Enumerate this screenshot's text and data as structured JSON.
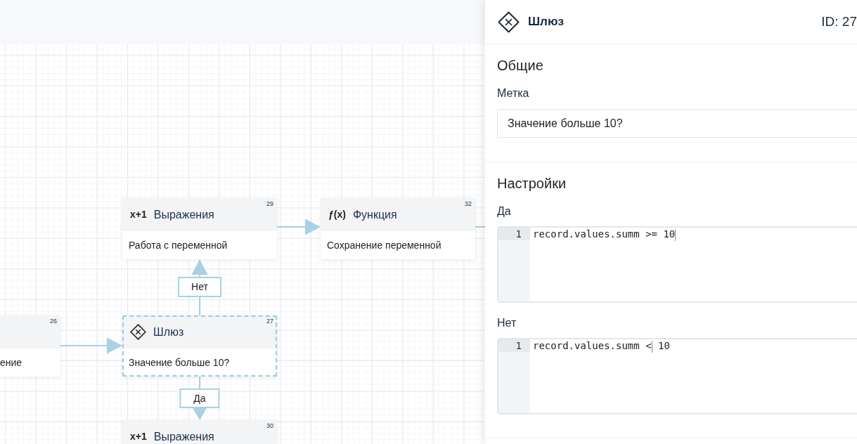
{
  "canvas": {
    "nodes": [
      {
        "kind": "expression",
        "icon": "x+1",
        "title": "Выражения",
        "number": "29",
        "description": "Работа с переменной",
        "selected": false
      },
      {
        "kind": "function",
        "icon": "ƒ(x)",
        "title": "Функция",
        "number": "32",
        "description": "Сохранение переменной",
        "selected": false
      },
      {
        "number": "26",
        "description": "ение",
        "selected": false
      },
      {
        "kind": "gateway",
        "title": "Шлюз",
        "number": "27",
        "description": "Значение больше 10?",
        "selected": true
      },
      {
        "kind": "expression",
        "icon": "x+1",
        "title": "Выражения",
        "number": "30",
        "selected": false
      }
    ],
    "edges": [
      {
        "label": "Нет"
      },
      {
        "label": "Да"
      }
    ]
  },
  "panel": {
    "kind": "gateway",
    "title": "Шлюз",
    "id_label": "ID: 27",
    "sections": [
      {
        "title": "Общие",
        "fields": [
          {
            "kind": "text",
            "label": "Метка",
            "value": "Значение больше 10?"
          }
        ]
      },
      {
        "title": "Настройки",
        "fields": [
          {
            "kind": "code",
            "label": "Да",
            "lines": [
              {
                "number": "1",
                "active": true,
                "before_caret": "record.values.summ >= 10"
              }
            ]
          },
          {
            "kind": "code",
            "label": "Нет",
            "lines": [
              {
                "number": "1",
                "active": true,
                "before_caret": "record.values.summ <",
                "after_caret": " 10"
              }
            ]
          }
        ]
      }
    ]
  }
}
